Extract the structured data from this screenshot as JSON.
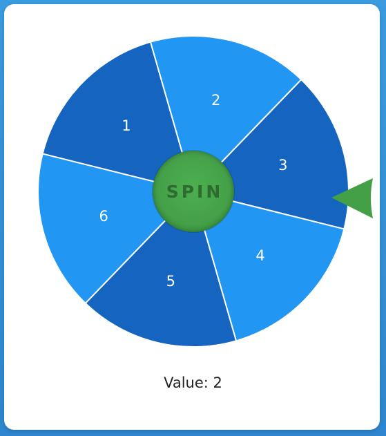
{
  "wheel": {
    "segments": [
      {
        "label": "1",
        "color": "#1565c0"
      },
      {
        "label": "2",
        "color": "#2196f3"
      },
      {
        "label": "3",
        "color": "#1565c0"
      },
      {
        "label": "4",
        "color": "#2196f3"
      },
      {
        "label": "5",
        "color": "#1565c0"
      },
      {
        "label": "6",
        "color": "#2196f3"
      }
    ],
    "spin_label": "SPIN",
    "spin_color": "#4caf50"
  },
  "pointer": {
    "color": "#43a047",
    "icon": "pointer-arrow-icon"
  },
  "result": {
    "text": "Value: 2"
  }
}
